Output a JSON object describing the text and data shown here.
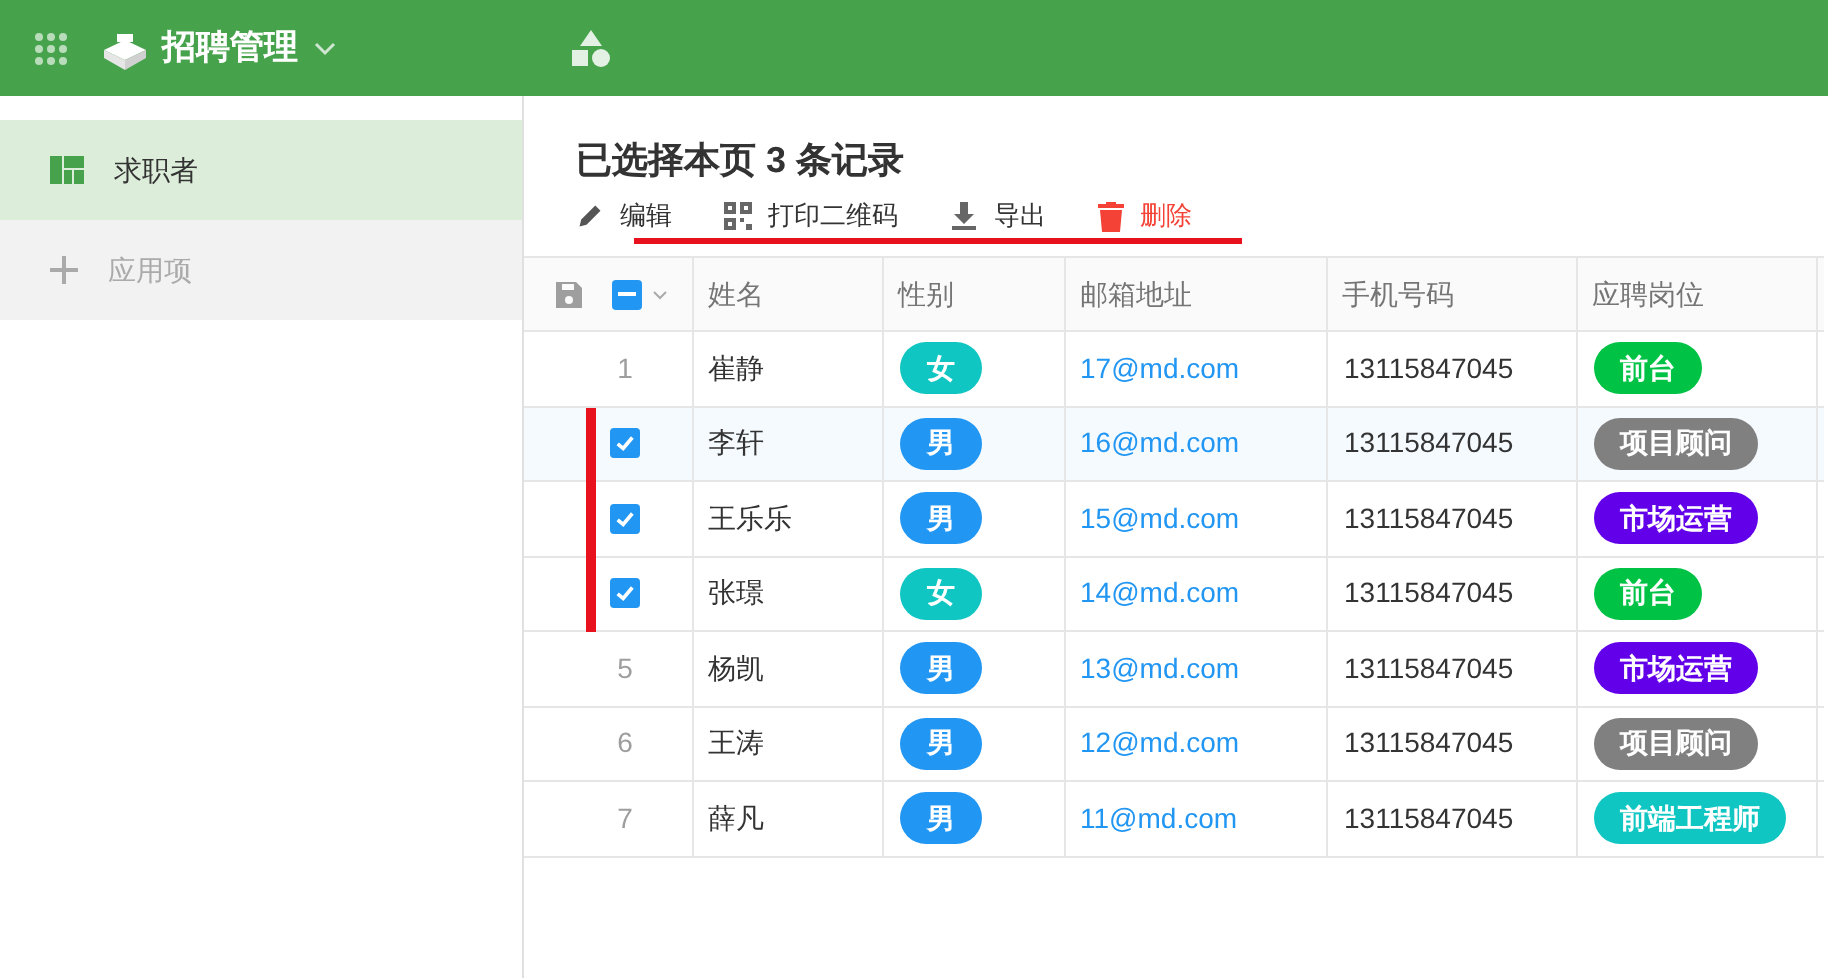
{
  "header": {
    "app_title": "招聘管理"
  },
  "sidebar": {
    "items": [
      {
        "label": "求职者",
        "selected": true,
        "kind": "sheet"
      },
      {
        "label": "应用项",
        "selected": false,
        "kind": "add"
      }
    ]
  },
  "selection_title": "已选择本页 3 条记录",
  "toolbar": [
    {
      "label": "编辑",
      "kind": "edit",
      "danger": false
    },
    {
      "label": "打印二维码",
      "kind": "qr",
      "danger": false
    },
    {
      "label": "导出",
      "kind": "export",
      "danger": false
    },
    {
      "label": "删除",
      "kind": "delete",
      "danger": true
    }
  ],
  "table": {
    "header_indeterminate": true,
    "columns": [
      "姓名",
      "性别",
      "邮箱地址",
      "手机号码",
      "应聘岗位"
    ],
    "rows": [
      {
        "number": "1",
        "checked": false,
        "hovered": false,
        "name": "崔静",
        "gender": {
          "text": "女",
          "color": "#0fc6c2"
        },
        "email": "17@md.com",
        "phone": "13115847045",
        "job": {
          "text": "前台",
          "color": "#00c345"
        }
      },
      {
        "checked": true,
        "hovered": true,
        "name": "李轩",
        "gender": {
          "text": "男",
          "color": "#2196f3"
        },
        "email": "16@md.com",
        "phone": "13115847045",
        "job": {
          "text": "项目顾问",
          "color": "#808080"
        }
      },
      {
        "checked": true,
        "hovered": false,
        "name": "王乐乐",
        "gender": {
          "text": "男",
          "color": "#2196f3"
        },
        "email": "15@md.com",
        "phone": "13115847045",
        "job": {
          "text": "市场运营",
          "color": "#6200ea"
        }
      },
      {
        "checked": true,
        "hovered": false,
        "name": "张璟",
        "gender": {
          "text": "女",
          "color": "#0fc6c2"
        },
        "email": "14@md.com",
        "phone": "13115847045",
        "job": {
          "text": "前台",
          "color": "#00c345"
        }
      },
      {
        "number": "5",
        "checked": false,
        "hovered": false,
        "name": "杨凯",
        "gender": {
          "text": "男",
          "color": "#2196f3"
        },
        "email": "13@md.com",
        "phone": "13115847045",
        "job": {
          "text": "市场运营",
          "color": "#6200ea"
        }
      },
      {
        "number": "6",
        "checked": false,
        "hovered": false,
        "name": "王涛",
        "gender": {
          "text": "男",
          "color": "#2196f3"
        },
        "email": "12@md.com",
        "phone": "13115847045",
        "job": {
          "text": "项目顾问",
          "color": "#808080"
        }
      },
      {
        "number": "7",
        "checked": false,
        "hovered": false,
        "name": "薛凡",
        "gender": {
          "text": "男",
          "color": "#2196f3"
        },
        "email": "11@md.com",
        "phone": "13115847045",
        "job": {
          "text": "前端工程师",
          "color": "#0fc6c2"
        }
      }
    ]
  }
}
